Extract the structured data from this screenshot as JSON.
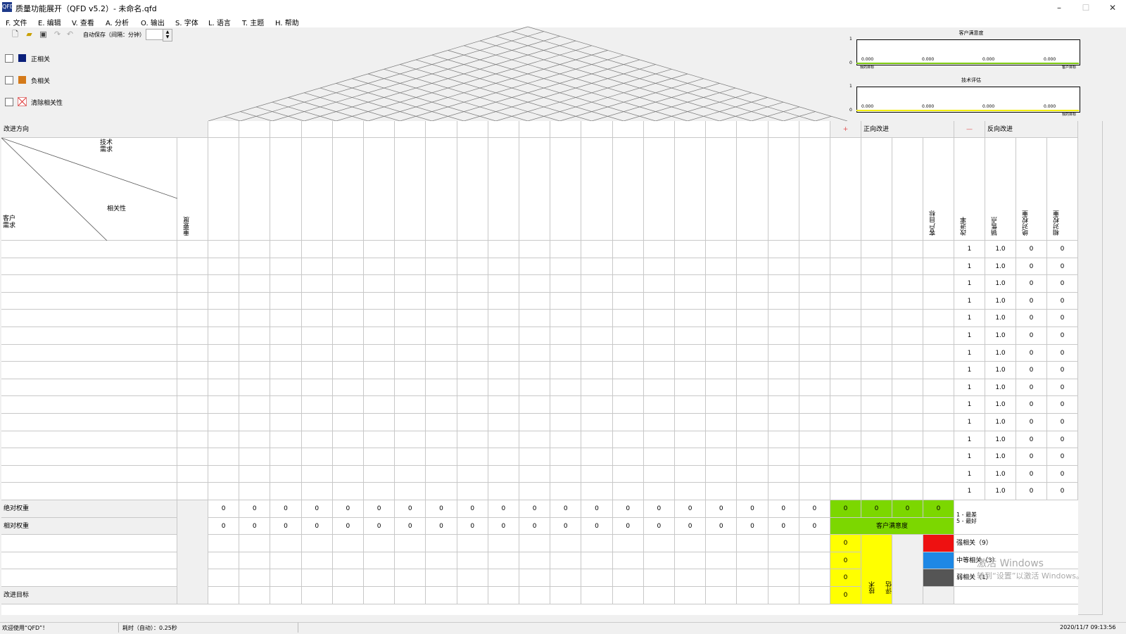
{
  "window": {
    "title": "质量功能展开（QFD  v5.2）- 未命名.qfd",
    "icon": "QFD"
  },
  "menu": [
    {
      "label": "F. 文件"
    },
    {
      "label": "E. 编辑"
    },
    {
      "label": "V. 查看"
    },
    {
      "label": "A. 分析"
    },
    {
      "label": "O. 输出"
    },
    {
      "label": "S. 字体"
    },
    {
      "label": "L. 语言"
    },
    {
      "label": "T. 主题"
    },
    {
      "label": "H. 帮助"
    }
  ],
  "toolbar": {
    "autosave_label": "自动保存（间隔：分钟）",
    "autosave_value": ""
  },
  "legend": {
    "positive": {
      "label": "正相关",
      "color": "#0a1f7a"
    },
    "negative": {
      "label": "负相关",
      "color": "#d47a1a"
    },
    "clear": {
      "label": "清除相关性"
    }
  },
  "mini_charts": [
    {
      "title": "客户满意度",
      "y_top": "1",
      "y_bottom": "0",
      "value_label": "0.000",
      "x_left": "我的目标",
      "x_right": "客户目标",
      "line_color": "#7ac70c"
    },
    {
      "title": "技术评估",
      "y_top": "1",
      "y_bottom": "0",
      "value_label": "0.000",
      "x_left": "",
      "x_right": "我的目标",
      "line_color": "#f2ee00"
    }
  ],
  "grid": {
    "improve_direction": "改进方向",
    "tech_req": "技术\n需求",
    "cust_req": "客户\n需求",
    "relation": "相关性",
    "importance": "重要度",
    "plus": "+",
    "positive_improve": "正向改进",
    "minus": "—",
    "negative_improve": "反向改进",
    "customer_target": "客户目标",
    "col_improve_rate": "改进率",
    "col_sales_point": "销售点",
    "col_abs_weight": "绝对权重",
    "col_rel_weight": "相对权重",
    "row_values": [
      "1",
      "1.0",
      "0",
      "0"
    ],
    "abs_weight": "绝对权重",
    "rel_weight": "相对权重",
    "cell_zero": "0",
    "cust_satisfaction": "客户满意度",
    "scale_note": "1 - 最差\n5 - 最好",
    "tech_eval": "技术\n评估",
    "strong": {
      "label": "强相关（9）",
      "color": "#ee1111"
    },
    "medium": {
      "label": "中等相关（3）",
      "color": "#1e88e5"
    },
    "weak": {
      "label": "弱相关（1）",
      "color": "#555555"
    },
    "improve_target": "改进目标",
    "green": "#7cd700",
    "yellow": "#ffff00"
  },
  "watermark": {
    "line1": "激活 Windows",
    "line2": "转到“设置”以激活 Windows。"
  },
  "status": {
    "welcome": "欢迎使用“QFD”！",
    "timing": "耗时（自动）：0.25秒",
    "datetime": "2020/11/7   09:13:56"
  }
}
